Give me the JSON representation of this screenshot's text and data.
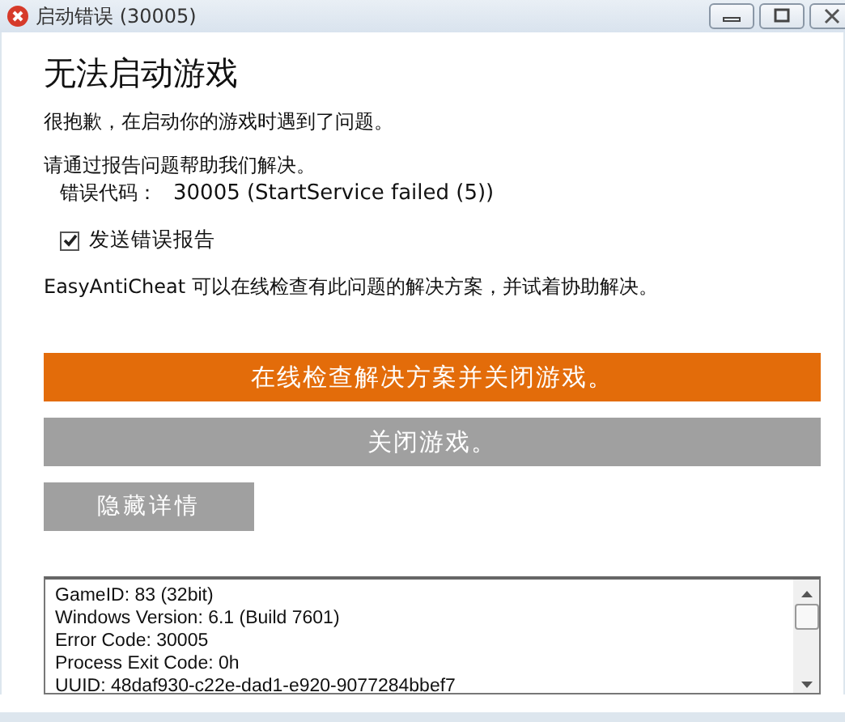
{
  "window": {
    "title": "启动错误 (30005)"
  },
  "heading": "无法启动游戏",
  "apology": "很抱歉，在启动你的游戏时遇到了问题。",
  "report_prompt": "请通过报告问题帮助我们解决。",
  "error_code": {
    "label": "错误代码：",
    "value": "30005 (StartService failed (5))"
  },
  "send_report": {
    "label": "发送错误报告",
    "checked": true
  },
  "info": "EasyAntiCheat 可以在线检查有此问题的解决方案，并试着协助解决。",
  "buttons": [
    {
      "label": "在线检查解决方案并关闭游戏。",
      "kind": "primary"
    },
    {
      "label": "关闭游戏。",
      "kind": "secondary"
    }
  ],
  "details_button": "隐藏详情",
  "details": [
    "GameID: 83 (32bit)",
    "Windows Version: 6.1 (Build 7601)",
    "Error Code: 30005",
    "Process Exit Code: 0h",
    "UUID: 48daf930-c22e-dad1-e920-9077284bbef7"
  ]
}
